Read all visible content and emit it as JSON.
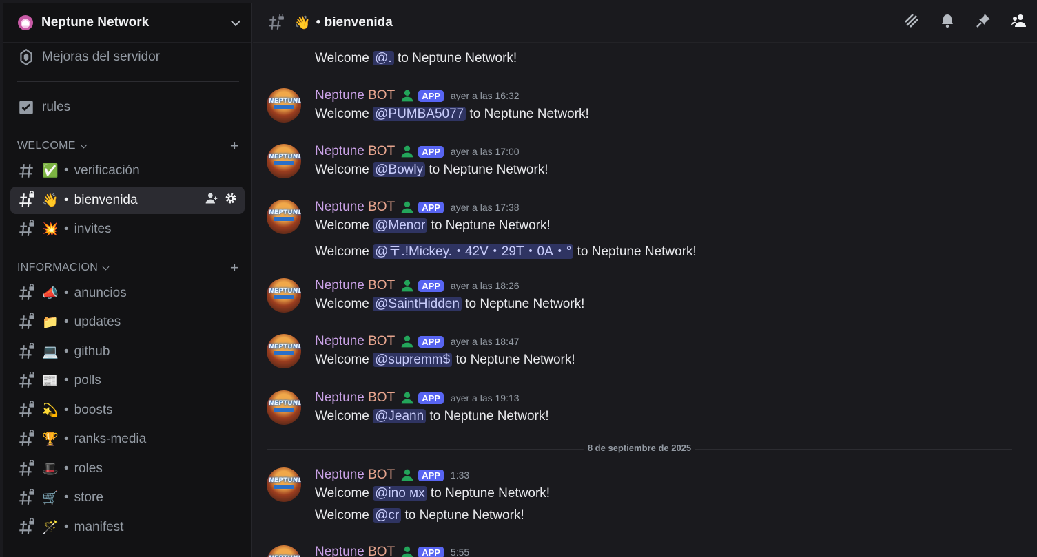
{
  "server": {
    "name": "Neptune Network"
  },
  "sidebar": {
    "boosts_label": "Mejoras del servidor",
    "rules_label": "rules",
    "categories": [
      {
        "name": "WELCOME"
      },
      {
        "name": "INFORMACION"
      }
    ],
    "channels": [
      {
        "emoji": "✅",
        "name": "verificación"
      },
      {
        "emoji": "👋",
        "name": "bienvenida"
      },
      {
        "emoji": "💥",
        "name": "invites"
      },
      {
        "emoji": "📣",
        "name": "anuncios"
      },
      {
        "emoji": "📁",
        "name": "updates"
      },
      {
        "emoji": "💻",
        "name": "github"
      },
      {
        "emoji": "📰",
        "name": "polls"
      },
      {
        "emoji": "💫",
        "name": "boosts"
      },
      {
        "emoji": "🏆",
        "name": "ranks-media"
      },
      {
        "emoji": "🎩",
        "name": "roles"
      },
      {
        "emoji": "🛒",
        "name": "store"
      },
      {
        "emoji": "🪄",
        "name": "manifest"
      }
    ]
  },
  "header": {
    "emoji": "👋",
    "channel": "bienvenida"
  },
  "bot": {
    "name_first": "Neptune",
    "name_second": "BOT",
    "tag": "APP"
  },
  "welcome": {
    "prefix": "Welcome",
    "suffix": "to Neptune Network!"
  },
  "messages": [
    {
      "mention": "@."
    },
    {
      "time": "ayer a las 16:32",
      "mention": "@PUMBA5077"
    },
    {
      "time": "ayer a las 17:00",
      "mention": "@Bowly"
    },
    {
      "time": "ayer a las 17:38",
      "mention": "@Menor"
    },
    {
      "mention": "@〒.!Mickey.・42V・29T・0A・°"
    },
    {
      "time": "ayer a las 18:26",
      "mention": "@SaintHidden"
    },
    {
      "time": "ayer a las 18:47",
      "mention": "@supremm$"
    },
    {
      "time": "ayer a las 19:13",
      "mention": "@Jeann"
    },
    {
      "time": "1:33",
      "mention": "@ino ᴍx"
    },
    {
      "mention": "@cr"
    },
    {
      "time": "5:55"
    }
  ],
  "date_divider": "8 de septiembre de 2025",
  "avatar_logo": "NEPTUNE"
}
